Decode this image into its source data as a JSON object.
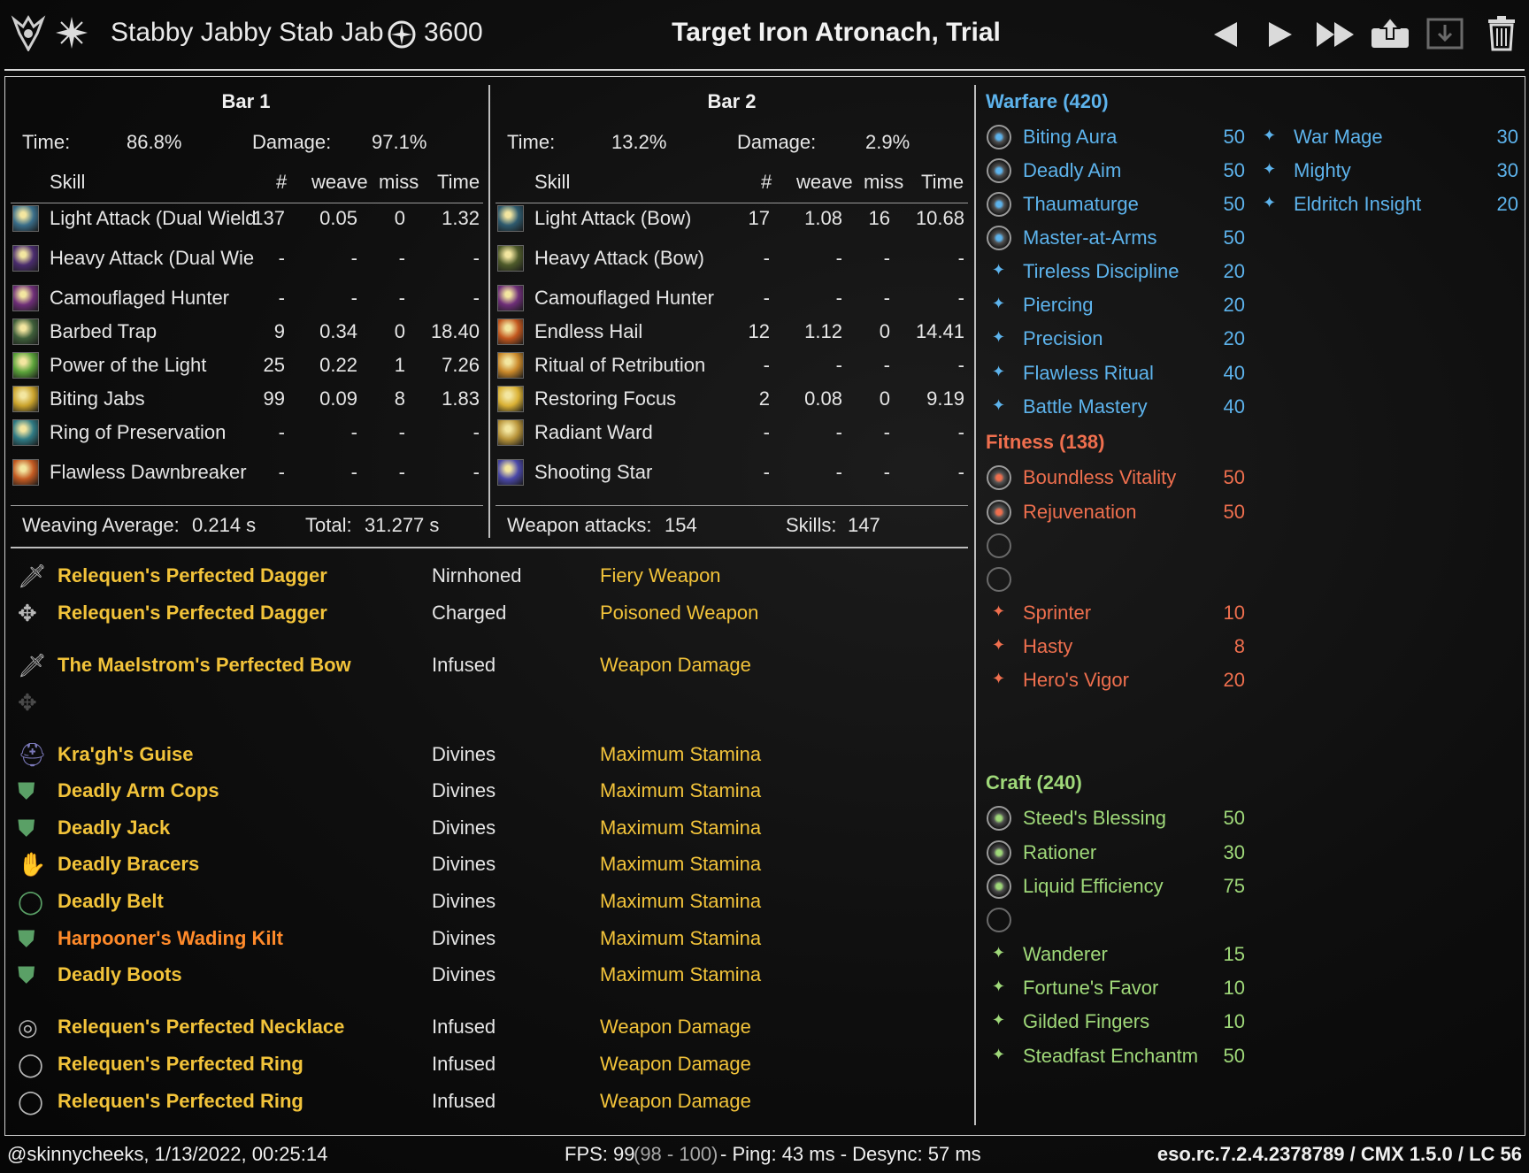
{
  "header": {
    "character_name": "Stabby Jabby Stab Jab",
    "champion_points": "3600",
    "target": "Target Iron Atronach, Trial",
    "icons": [
      "class-emblem-icon",
      "star-burst-icon",
      "cp-icon",
      "prev-icon",
      "play-icon",
      "fast-forward-icon",
      "upload-icon",
      "save-icon",
      "trash-icon"
    ]
  },
  "bar1": {
    "title": "Bar 1",
    "time_label": "Time:",
    "time_value": "86.8%",
    "damage_label": "Damage:",
    "damage_value": "97.1%",
    "columns": [
      "Skill",
      "#",
      "weave",
      "miss",
      "Time"
    ],
    "rows": [
      {
        "skill": "Light Attack (Dual Wield",
        "count": "137",
        "weave": "0.05",
        "miss": "0",
        "time": "1.32",
        "icon": "dual-wield-light-icon",
        "color": "#3a6e8a"
      },
      {
        "skill": "Heavy Attack (Dual Wie",
        "count": "-",
        "weave": "-",
        "miss": "-",
        "time": "-",
        "icon": "dual-wield-heavy-icon",
        "color": "#4a2c6e"
      },
      {
        "skill": "Camouflaged Hunter",
        "count": "-",
        "weave": "-",
        "miss": "-",
        "time": "-",
        "icon": "camouflaged-hunter-icon",
        "color": "#6e2e78"
      },
      {
        "skill": "Barbed Trap",
        "count": "9",
        "weave": "0.34",
        "miss": "0",
        "time": "18.40",
        "icon": "barbed-trap-icon",
        "color": "#3e5e3a"
      },
      {
        "skill": "Power of the Light",
        "count": "25",
        "weave": "0.22",
        "miss": "1",
        "time": "7.26",
        "icon": "power-of-light-icon",
        "color": "#5aa23a"
      },
      {
        "skill": "Biting Jabs",
        "count": "99",
        "weave": "0.09",
        "miss": "8",
        "time": "1.83",
        "icon": "biting-jabs-icon",
        "color": "#c9a22c"
      },
      {
        "skill": "Ring of Preservation",
        "count": "-",
        "weave": "-",
        "miss": "-",
        "time": "-",
        "icon": "ring-of-preservation-icon",
        "color": "#2f7a84"
      },
      {
        "skill": "Flawless Dawnbreaker",
        "count": "-",
        "weave": "-",
        "miss": "-",
        "time": "-",
        "icon": "flawless-dawnbreaker-icon",
        "color": "#c25a22"
      }
    ],
    "footer_left_label": "Weaving Average:",
    "footer_left_value": "0.214 s",
    "footer_right_label": "Total:",
    "footer_right_value": "31.277 s"
  },
  "bar2": {
    "title": "Bar 2",
    "time_label": "Time:",
    "time_value": "13.2%",
    "damage_label": "Damage:",
    "damage_value": "2.9%",
    "columns": [
      "Skill",
      "#",
      "weave",
      "miss",
      "Time"
    ],
    "rows": [
      {
        "skill": "Light Attack (Bow)",
        "count": "17",
        "weave": "1.08",
        "miss": "16",
        "time": "10.68",
        "icon": "bow-light-icon",
        "color": "#2e5a6e"
      },
      {
        "skill": "Heavy Attack (Bow)",
        "count": "-",
        "weave": "-",
        "miss": "-",
        "time": "-",
        "icon": "bow-heavy-icon",
        "color": "#4e5a2a"
      },
      {
        "skill": "Camouflaged Hunter",
        "count": "-",
        "weave": "-",
        "miss": "-",
        "time": "-",
        "icon": "camouflaged-hunter-icon",
        "color": "#6e2e78"
      },
      {
        "skill": "Endless Hail",
        "count": "12",
        "weave": "1.12",
        "miss": "0",
        "time": "14.41",
        "icon": "endless-hail-icon",
        "color": "#c2571e"
      },
      {
        "skill": "Ritual of Retribution",
        "count": "-",
        "weave": "-",
        "miss": "-",
        "time": "-",
        "icon": "ritual-of-retribution-icon",
        "color": "#c9882a"
      },
      {
        "skill": "Restoring Focus",
        "count": "2",
        "weave": "0.08",
        "miss": "0",
        "time": "9.19",
        "icon": "restoring-focus-icon",
        "color": "#d9b034"
      },
      {
        "skill": "Radiant Ward",
        "count": "-",
        "weave": "-",
        "miss": "-",
        "time": "-",
        "icon": "radiant-ward-icon",
        "color": "#b8943a"
      },
      {
        "skill": "Shooting Star",
        "count": "-",
        "weave": "-",
        "miss": "-",
        "time": "-",
        "icon": "shooting-star-icon",
        "color": "#4a48a8"
      }
    ],
    "footer_left_label": "Weapon attacks:",
    "footer_left_value": "154",
    "footer_right_label": "Skills:",
    "footer_right_value": "147"
  },
  "gear": [
    {
      "name": "Relequen's Perfected Dagger",
      "trait": "Nirnhoned",
      "enchant": "Fiery Weapon",
      "quality": "legendary",
      "icon": "dagger-icon"
    },
    {
      "name": "Relequen's Perfected Dagger",
      "trait": "Charged",
      "enchant": "Poisoned Weapon",
      "quality": "legendary",
      "icon": "dagger-poison-icon"
    },
    {
      "name": "The Maelstrom's Perfected Bow",
      "trait": "Infused",
      "enchant": "Weapon Damage",
      "quality": "legendary",
      "icon": "bow-icon"
    },
    {
      "name": "",
      "trait": "",
      "enchant": "",
      "quality": "empty",
      "icon": "empty-slot-icon"
    },
    {
      "name": "Kra'gh's Guise",
      "trait": "Divines",
      "enchant": "Maximum Stamina",
      "quality": "legendary",
      "icon": "helmet-icon"
    },
    {
      "name": "Deadly Arm Cops",
      "trait": "Divines",
      "enchant": "Maximum Stamina",
      "quality": "legendary",
      "icon": "shoulders-icon"
    },
    {
      "name": "Deadly Jack",
      "trait": "Divines",
      "enchant": "Maximum Stamina",
      "quality": "legendary",
      "icon": "chest-icon"
    },
    {
      "name": "Deadly Bracers",
      "trait": "Divines",
      "enchant": "Maximum Stamina",
      "quality": "legendary",
      "icon": "gloves-icon"
    },
    {
      "name": "Deadly Belt",
      "trait": "Divines",
      "enchant": "Maximum Stamina",
      "quality": "legendary",
      "icon": "belt-icon"
    },
    {
      "name": "Harpooner's Wading Kilt",
      "trait": "Divines",
      "enchant": "Maximum Stamina",
      "quality": "epic",
      "icon": "legs-icon"
    },
    {
      "name": "Deadly Boots",
      "trait": "Divines",
      "enchant": "Maximum Stamina",
      "quality": "legendary",
      "icon": "boots-icon"
    },
    {
      "name": "Relequen's Perfected Necklace",
      "trait": "Infused",
      "enchant": "Weapon Damage",
      "quality": "legendary",
      "icon": "necklace-icon"
    },
    {
      "name": "Relequen's Perfected Ring",
      "trait": "Infused",
      "enchant": "Weapon Damage",
      "quality": "legendary",
      "icon": "ring-icon"
    },
    {
      "name": "Relequen's Perfected Ring",
      "trait": "Infused",
      "enchant": "Weapon Damage",
      "quality": "legendary",
      "icon": "ring-icon"
    }
  ],
  "champion": {
    "warfare": {
      "title": "Warfare (420)",
      "color": "#5db3ec",
      "slotted": [
        {
          "name": "Biting Aura",
          "points": "50"
        },
        {
          "name": "Deadly Aim",
          "points": "50"
        },
        {
          "name": "Thaumaturge",
          "points": "50"
        },
        {
          "name": "Master-at-Arms",
          "points": "50"
        }
      ],
      "passive": [
        {
          "name": "Tireless Discipline",
          "points": "20"
        },
        {
          "name": "Piercing",
          "points": "20"
        },
        {
          "name": "Precision",
          "points": "20"
        },
        {
          "name": "Flawless Ritual",
          "points": "40"
        },
        {
          "name": "Battle Mastery",
          "points": "40"
        }
      ],
      "extra": [
        {
          "name": "War Mage",
          "points": "30"
        },
        {
          "name": "Mighty",
          "points": "30"
        },
        {
          "name": "Eldritch Insight",
          "points": "20"
        }
      ]
    },
    "fitness": {
      "title": "Fitness (138)",
      "color": "#ef6f4e",
      "slotted": [
        {
          "name": "Boundless Vitality",
          "points": "50"
        },
        {
          "name": "Rejuvenation",
          "points": "50"
        },
        {
          "name": "",
          "points": ""
        },
        {
          "name": "",
          "points": ""
        }
      ],
      "passive": [
        {
          "name": "Sprinter",
          "points": "10"
        },
        {
          "name": "Hasty",
          "points": "8"
        },
        {
          "name": "Hero's Vigor",
          "points": "20"
        }
      ]
    },
    "craft": {
      "title": "Craft (240)",
      "color": "#9fd879",
      "slotted": [
        {
          "name": "Steed's Blessing",
          "points": "50"
        },
        {
          "name": "Rationer",
          "points": "30"
        },
        {
          "name": "Liquid Efficiency",
          "points": "75"
        },
        {
          "name": "",
          "points": ""
        }
      ],
      "passive": [
        {
          "name": "Wanderer",
          "points": "15"
        },
        {
          "name": "Fortune's Favor",
          "points": "10"
        },
        {
          "name": "Gilded Fingers",
          "points": "10"
        },
        {
          "name": "Steadfast Enchantm",
          "points": "50"
        }
      ]
    }
  },
  "footer": {
    "user_info": "@skinnycheeks, 1/13/2022, 00:25:14",
    "fps_label": "FPS: 99",
    "fps_range": "(98 - 100)",
    "ping_info": "- Ping: 43 ms - Desync: 57 ms",
    "version": "eso.rc.7.2.4.2378789 / CMX 1.5.0 / LC 56"
  }
}
